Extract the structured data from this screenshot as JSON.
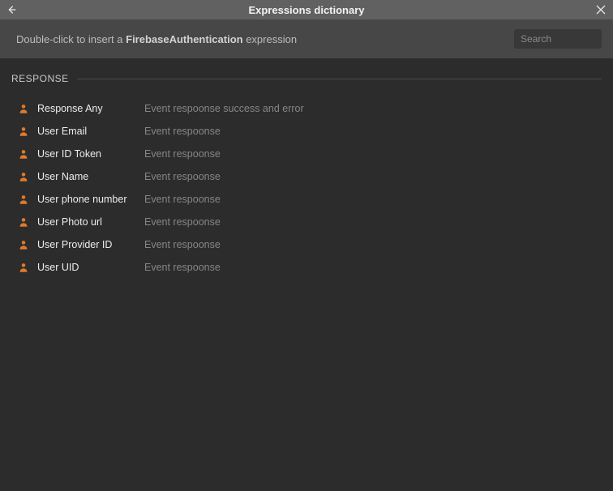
{
  "window": {
    "title": "Expressions dictionary"
  },
  "toolbar": {
    "instruction_prefix": "Double-click to insert a ",
    "instruction_bold": "FirebaseAuthentication",
    "instruction_suffix": " expression",
    "search_placeholder": "Search"
  },
  "section": {
    "title": "RESPONSE"
  },
  "icon_color": "#e07a2b",
  "items": [
    {
      "name": "Response Any",
      "desc": "Event respoonse success and error"
    },
    {
      "name": "User Email",
      "desc": "Event respoonse"
    },
    {
      "name": "User ID Token",
      "desc": "Event respoonse"
    },
    {
      "name": "User Name",
      "desc": "Event respoonse"
    },
    {
      "name": "User phone number",
      "desc": "Event respoonse"
    },
    {
      "name": "User Photo url",
      "desc": "Event respoonse"
    },
    {
      "name": "User Provider ID",
      "desc": "Event respoonse"
    },
    {
      "name": "User UID",
      "desc": "Event respoonse"
    }
  ]
}
